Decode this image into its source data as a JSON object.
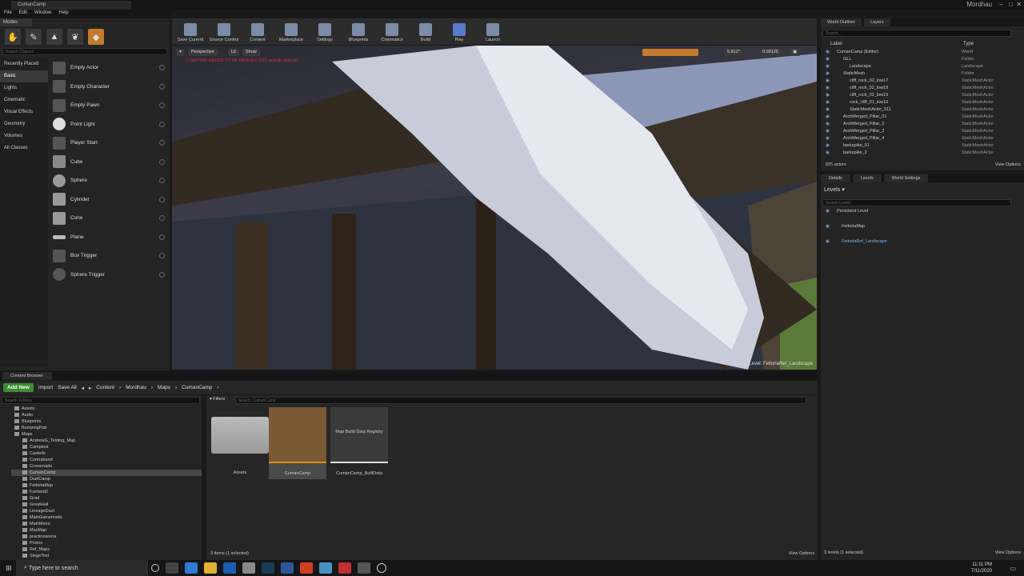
{
  "titlebar": {
    "tab_label": "CumanCamp",
    "project": "Mordhau"
  },
  "menu": [
    "File",
    "Edit",
    "Window",
    "Help"
  ],
  "modes_panel": {
    "tab_label": "Modes",
    "search_placeholder": "Search Classes",
    "categories": [
      "Recently Placed",
      "Basic",
      "Lights",
      "Cinematic",
      "Visual Effects",
      "Geometry",
      "Volumes",
      "All Classes"
    ],
    "selected_category": "Basic",
    "items": [
      "Empty Actor",
      "Empty Character",
      "Empty Pawn",
      "Point Light",
      "Player Start",
      "Cube",
      "Sphere",
      "Cylinder",
      "Cone",
      "Plane",
      "Box Trigger",
      "Sphere Trigger"
    ]
  },
  "toolbar": [
    "Save Current",
    "Source Control",
    "Content",
    "Marketplace",
    "Settings",
    "Blueprints",
    "Cinematics",
    "Build",
    "Play",
    "Launch"
  ],
  "viewport": {
    "perspective": "Perspective",
    "lit": "Lit",
    "show": "Show",
    "warning": "LIGHTING NEEDS TO BE REBUILT (521 unbuilt objects)",
    "grid_value": "5.812°",
    "scale_value": "0.03125",
    "level_label": "Level:",
    "level_name": "FeitoriaRef_Landscape"
  },
  "outliner": {
    "tabs": [
      "World Outliner",
      "Layers"
    ],
    "search_placeholder": "Search...",
    "col_label": "Label",
    "col_type": "Type",
    "rows": [
      {
        "name": "CumanCamp (Editor)",
        "type": "World",
        "indent": 0
      },
      {
        "name": "GLL",
        "type": "Folder",
        "indent": 1
      },
      {
        "name": "Landscape",
        "type": "Landscape",
        "indent": 2
      },
      {
        "name": "StaticMesh",
        "type": "Folder",
        "indent": 1
      },
      {
        "name": "cliff_rock_02_low17",
        "type": "StaticMeshActor",
        "indent": 2
      },
      {
        "name": "cliff_rock_02_low18",
        "type": "StaticMeshActor",
        "indent": 2
      },
      {
        "name": "cliff_rock_02_low19",
        "type": "StaticMeshActor",
        "indent": 2
      },
      {
        "name": "rock_cliff_01_low10",
        "type": "StaticMeshActor",
        "indent": 2
      },
      {
        "name": "StaticMeshActor_511",
        "type": "StaticMeshActor",
        "indent": 2
      },
      {
        "name": "ArchMerged_Pillar_01",
        "type": "StaticMeshActor",
        "indent": 1
      },
      {
        "name": "ArchMerged_Pillar_2",
        "type": "StaticMeshActor",
        "indent": 1
      },
      {
        "name": "ArchMerged_Pillar_3",
        "type": "StaticMeshActor",
        "indent": 1
      },
      {
        "name": "ArchMerged_Pillar_4",
        "type": "StaticMeshActor",
        "indent": 1
      },
      {
        "name": "barkspike_01",
        "type": "StaticMeshActor",
        "indent": 1
      },
      {
        "name": "barkspike_2",
        "type": "StaticMeshActor",
        "indent": 1
      }
    ],
    "actor_count": "825 actors",
    "view_options": "View Options"
  },
  "details": {
    "tabs": [
      "Details",
      "Levels",
      "World Settings"
    ],
    "levels_dropdown": "Levels",
    "search_placeholder": "Search Levels",
    "levels": [
      "Persistent Level",
      "FeitoriaMap",
      "FeitoriaRef_Landscape"
    ],
    "footer": "3 levels (1 selected)",
    "view_options": "View Options"
  },
  "content_browser": {
    "tab_label": "Content Browser",
    "add_new": "Add New",
    "import": "Import",
    "save_all": "Save All",
    "breadcrumb": [
      "Content",
      "Mordhau",
      "Maps",
      "CumanCamp"
    ],
    "search_folders": "Search Folders",
    "filters": "Filters",
    "search_assets": "Search CumanCamp",
    "folders": [
      "Assets",
      "Audio",
      "Blueprints",
      "BumpingPub",
      "Maps",
      "AndrewG_Testing_Map",
      "Camptest",
      "Castello",
      "Contraband",
      "Crossroads",
      "CumanCamp",
      "DuelCamp",
      "FeitoriaMap",
      "Funland2",
      "Grad",
      "GreatHall",
      "LineageDuel",
      "MainGamemode",
      "MainMenu",
      "MaxMap",
      "practicearena",
      "Promo",
      "Ref_Maps",
      "SiegeTest"
    ],
    "selected_folder": "CumanCamp",
    "assets": [
      {
        "name": "Assets",
        "thumb_text": ""
      },
      {
        "name": "CumanCamp",
        "thumb_text": ""
      },
      {
        "name": "CumanCamp_BuiltData",
        "thumb_text": "Map Build Data Registry"
      }
    ],
    "status": "3 items (1 selected)",
    "view_options": "View Options"
  },
  "taskbar": {
    "search_placeholder": "Type here to search",
    "time": "11:11 PM",
    "date": "7/11/2020"
  }
}
